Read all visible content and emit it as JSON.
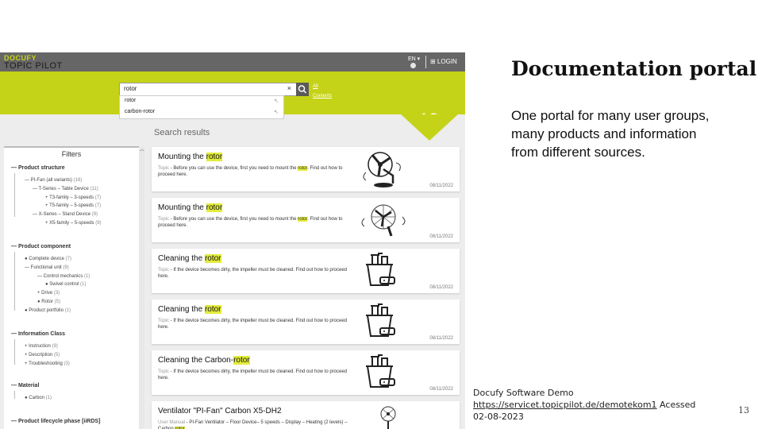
{
  "portal": {
    "logo_top": "DOCUFY",
    "logo_bottom": "TOPIC PILOT",
    "lang": "EN ▾",
    "login": "⊞ LOGIN",
    "search_value": "rotor",
    "search_clear": "×",
    "link_all": "All",
    "link_contents": "Contents",
    "suggestions": [
      "rotor",
      "carbon-rotor"
    ],
    "result_count": "18",
    "results_title": "Search results"
  },
  "filters": {
    "title": "Filters",
    "groups": [
      {
        "header": "— Product structure",
        "items": [
          {
            "text": "— PI-Fan (all variants)",
            "count": "(18)"
          },
          {
            "text": "— T-Series – Table Device",
            "count": "(11)"
          },
          {
            "text": "+ T3-family – 3-speeds",
            "count": "(7)"
          },
          {
            "text": "+ T5-family – 5-speeds",
            "count": "(7)"
          },
          {
            "text": "— X-Series – Stand Device",
            "count": "(9)"
          },
          {
            "text": "+ X5-family – 5-speeds",
            "count": "(9)"
          }
        ]
      },
      {
        "header": "— Product component",
        "items": [
          {
            "text": "● Complete device",
            "count": "(7)"
          },
          {
            "text": "— Functional unit",
            "count": "(9)"
          },
          {
            "text": "— Control mechanics",
            "count": "(1)"
          },
          {
            "text": "● Swivel control",
            "count": "(1)"
          },
          {
            "text": "+ Drive",
            "count": "(3)"
          },
          {
            "text": "● Rotor",
            "count": "(5)"
          },
          {
            "text": "● Product portfolio",
            "count": "(1)"
          }
        ]
      },
      {
        "header": "— Information Class",
        "items": [
          {
            "text": "+ Instruction",
            "count": "(9)"
          },
          {
            "text": "+ Description",
            "count": "(5)"
          },
          {
            "text": "+ Troubleshooting",
            "count": "(3)"
          }
        ]
      },
      {
        "header": "— Material",
        "items": [
          {
            "text": "● Carbon",
            "count": "(1)"
          }
        ]
      },
      {
        "header": "— Product lifecycle phase [iiRDS]",
        "items": []
      }
    ]
  },
  "results": [
    {
      "title_pre": "Mounting the ",
      "title_hl": "rotor",
      "title_post": "",
      "kind": "Topic",
      "text_pre": " - Before you can use the device, first you need to mount the ",
      "text_hl": "rotor",
      "text_post": ". Find out how to proceed here.",
      "date": "08/11/2022",
      "icon": "table-fan-icon"
    },
    {
      "title_pre": "Mounting the ",
      "title_hl": "rotor",
      "title_post": "",
      "kind": "Topic",
      "text_pre": " - Before you can use the device, first you need to mount the ",
      "text_hl": "rotor",
      "text_post": ". Find out how to proceed here.",
      "date": "08/11/2022",
      "icon": "fan-cage-icon"
    },
    {
      "title_pre": "Cleaning the ",
      "title_hl": "rotor",
      "title_post": "",
      "kind": "Topic",
      "text_pre": " - If the device becomes dirty, the impeller must be cleaned. Find out how to proceed here.",
      "text_hl": "",
      "text_post": "",
      "date": "08/11/2022",
      "icon": "cleaning-bucket-icon"
    },
    {
      "title_pre": "Cleaning the ",
      "title_hl": "rotor",
      "title_post": "",
      "kind": "Topic",
      "text_pre": " - If the device becomes dirty, the impeller must be cleaned. Find out how to proceed here.",
      "text_hl": "",
      "text_post": "",
      "date": "08/11/2022",
      "icon": "cleaning-bucket-icon"
    },
    {
      "title_pre": "Cleaning the Carbon-",
      "title_hl": "rotor",
      "title_post": "",
      "kind": "Topic",
      "text_pre": " - If the device becomes dirty, the impeller must be cleaned. Find out how to proceed here.",
      "text_hl": "",
      "text_post": "",
      "date": "08/11/2022",
      "icon": "cleaning-bucket-icon"
    },
    {
      "title_pre": "Ventilator \"PI-Fan\" Carbon X5-DH2",
      "title_hl": "",
      "title_post": "",
      "kind": "User Manual",
      "text_pre": " - PI-Fan Ventilator – Floor Device– 5 speeds – Display – Heating (2 levels) – Carbon ",
      "text_hl": "rotor",
      "text_post": "",
      "date": "",
      "icon": "stand-fan-icon"
    }
  ],
  "slide": {
    "title": "Documentation portal",
    "description": "One portal for many user groups, many products and information from different sources.",
    "credit_line1": "Docufy Software Demo",
    "credit_url": "https://servicet.topicpilot.de/demotekom1",
    "credit_after": " Acessed",
    "credit_date": "02-08-2023",
    "page_number": "13"
  },
  "colors": {
    "accent": "#c5d318",
    "topbar": "#666666",
    "highlight": "#e3ec3c"
  }
}
